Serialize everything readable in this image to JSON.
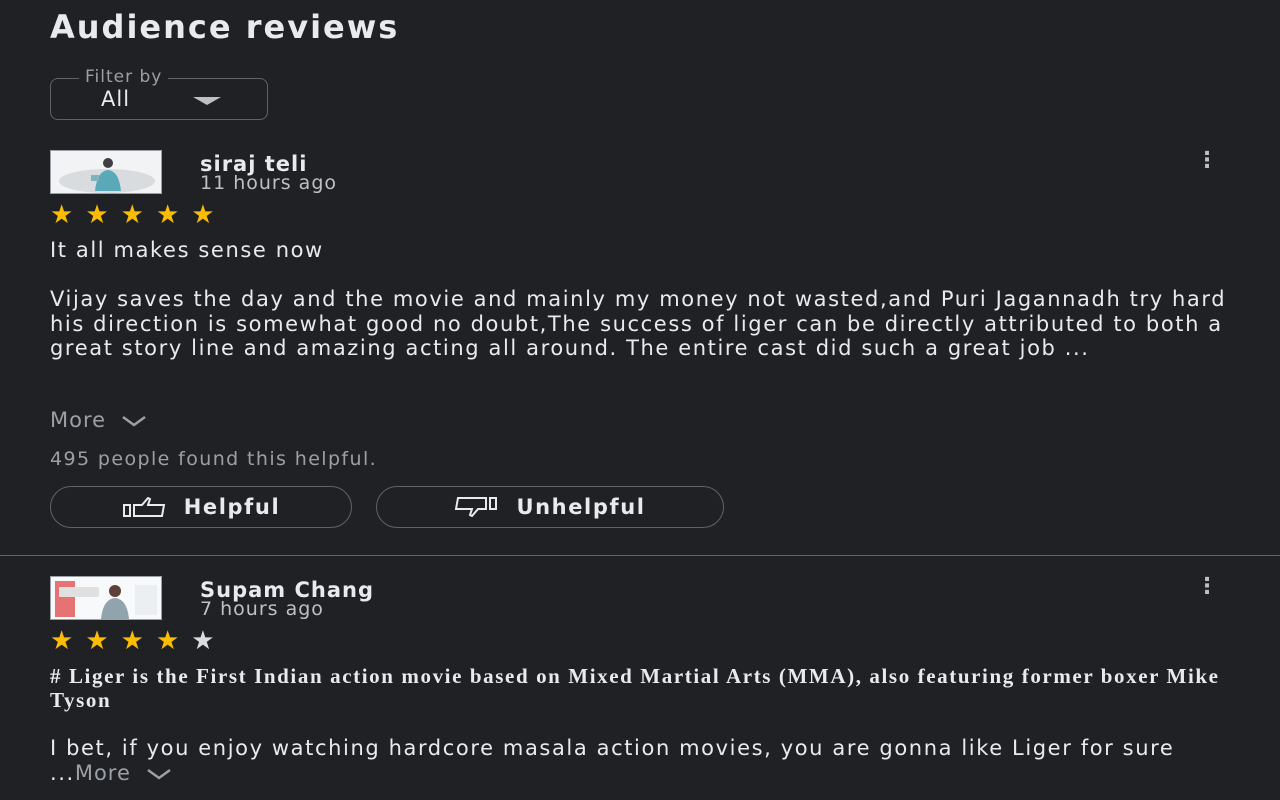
{
  "header": {
    "title": "Audience reviews"
  },
  "filter": {
    "label": "Filter by",
    "value": "All"
  },
  "reviews": [
    {
      "author": "siraj teli",
      "time": "11 hours ago",
      "rating": 5,
      "rating_max": 5,
      "headline": "It all makes sense now",
      "body": "Vijay saves the day and the movie and mainly my money not wasted,and Puri Jagannadh try hard his direction is somewhat good no doubt,The success of liger can be directly attributed to both a great story line and amazing acting all around. The entire cast did such a great job  ...",
      "more_label": "More",
      "helpful_count_text": "495 people found this helpful.",
      "helpful_label": "Helpful",
      "unhelpful_label": "Unhelpful"
    },
    {
      "author": "Supam Chang",
      "time": "7 hours ago",
      "rating": 4,
      "rating_max": 5,
      "headline": "# Liger is the First Indian action movie based on Mixed Martial Arts (MMA), also featuring former boxer Mike Tyson",
      "body": "I bet, if you enjoy watching hardcore masala action movies, you are gonna like Liger for sure ...",
      "more_label": "More"
    }
  ],
  "icons": {
    "more": "more-vert-icon",
    "thumb_up": "thumb-up-icon",
    "thumb_down": "thumb-down-icon",
    "expand": "chevron-down-icon",
    "dropdown": "dropdown-arrow-icon"
  },
  "colors": {
    "background": "#202124",
    "star": "#fbbc04",
    "text": "#e8eaed",
    "muted": "#9aa0a6"
  }
}
